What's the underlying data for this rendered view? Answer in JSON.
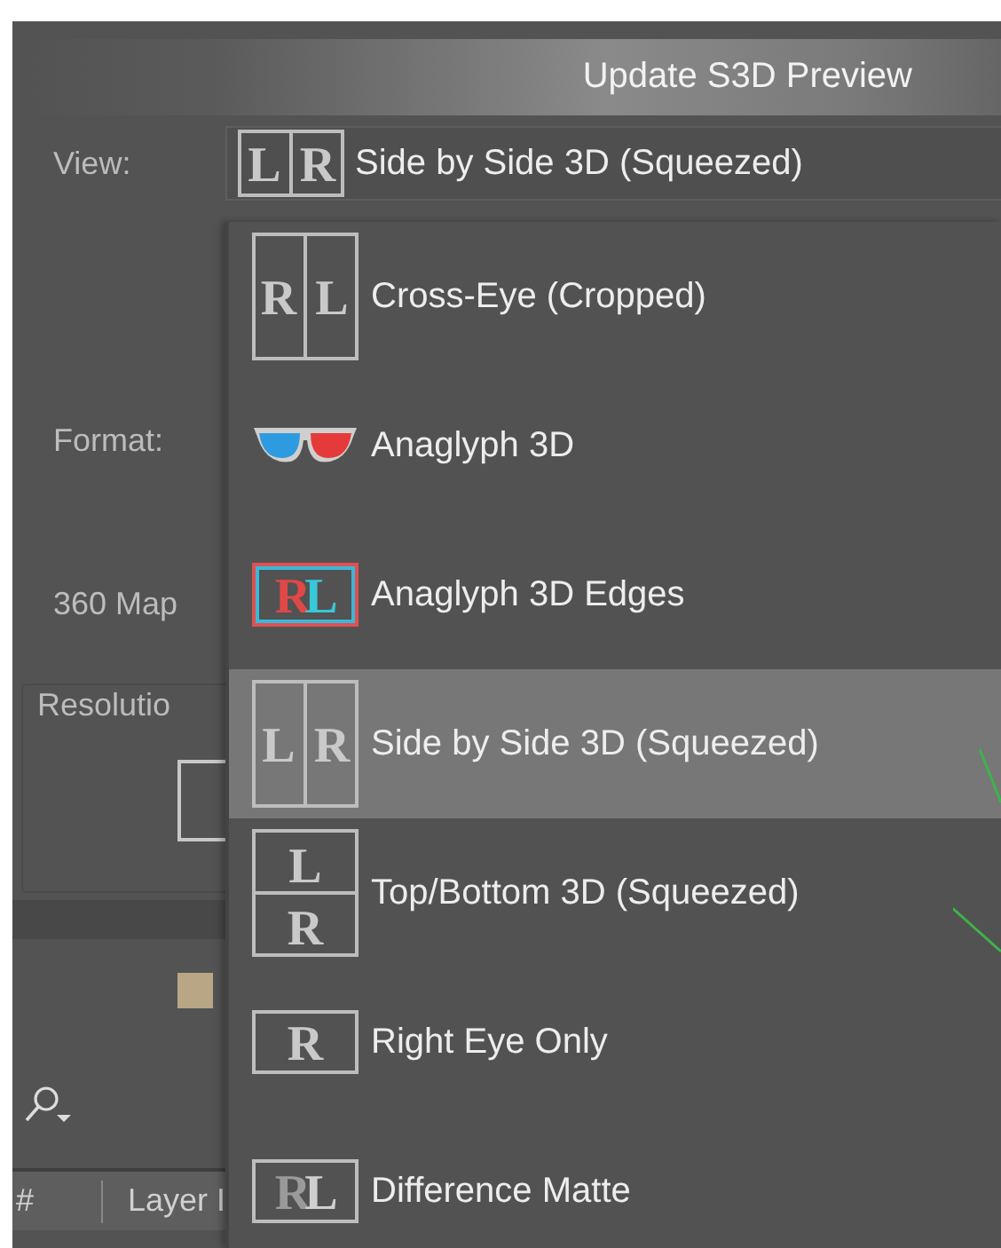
{
  "header": {
    "button": "Update S3D Preview"
  },
  "view": {
    "label": "View:",
    "value": "Side by Side 3D (Squeezed)",
    "icon": {
      "kind": "split",
      "letters": [
        "L",
        "R"
      ]
    }
  },
  "settings": [
    {
      "label": "Format:"
    },
    {
      "label": "360 Map"
    },
    {
      "label": "Resolutio"
    }
  ],
  "layers_header": {
    "column_1": "#",
    "column_2": "Layer I"
  },
  "menu": {
    "items": [
      {
        "label": "Cross-Eye (Cropped)",
        "selected": false,
        "icon": {
          "kind": "split",
          "letters": [
            "R",
            "L"
          ]
        }
      },
      {
        "label": "Anaglyph 3D",
        "selected": false,
        "icon": {
          "kind": "glasses"
        }
      },
      {
        "label": "Anaglyph 3D Edges",
        "selected": false,
        "icon": {
          "kind": "anaglyph",
          "letters": [
            "R",
            "L"
          ]
        }
      },
      {
        "label": "Side by Side 3D (Squeezed)",
        "selected": true,
        "icon": {
          "kind": "split",
          "letters": [
            "L",
            "R"
          ]
        }
      },
      {
        "label": "Top/Bottom 3D (Squeezed)",
        "selected": false,
        "icon": {
          "kind": "stack",
          "letters": [
            "L",
            "R"
          ]
        }
      },
      {
        "label": "Right Eye Only",
        "selected": false,
        "icon": {
          "kind": "single",
          "letters": [
            "R"
          ]
        }
      },
      {
        "label": "Difference Matte",
        "selected": false,
        "icon": {
          "kind": "difference",
          "letters": [
            "R",
            "L"
          ]
        }
      }
    ]
  }
}
